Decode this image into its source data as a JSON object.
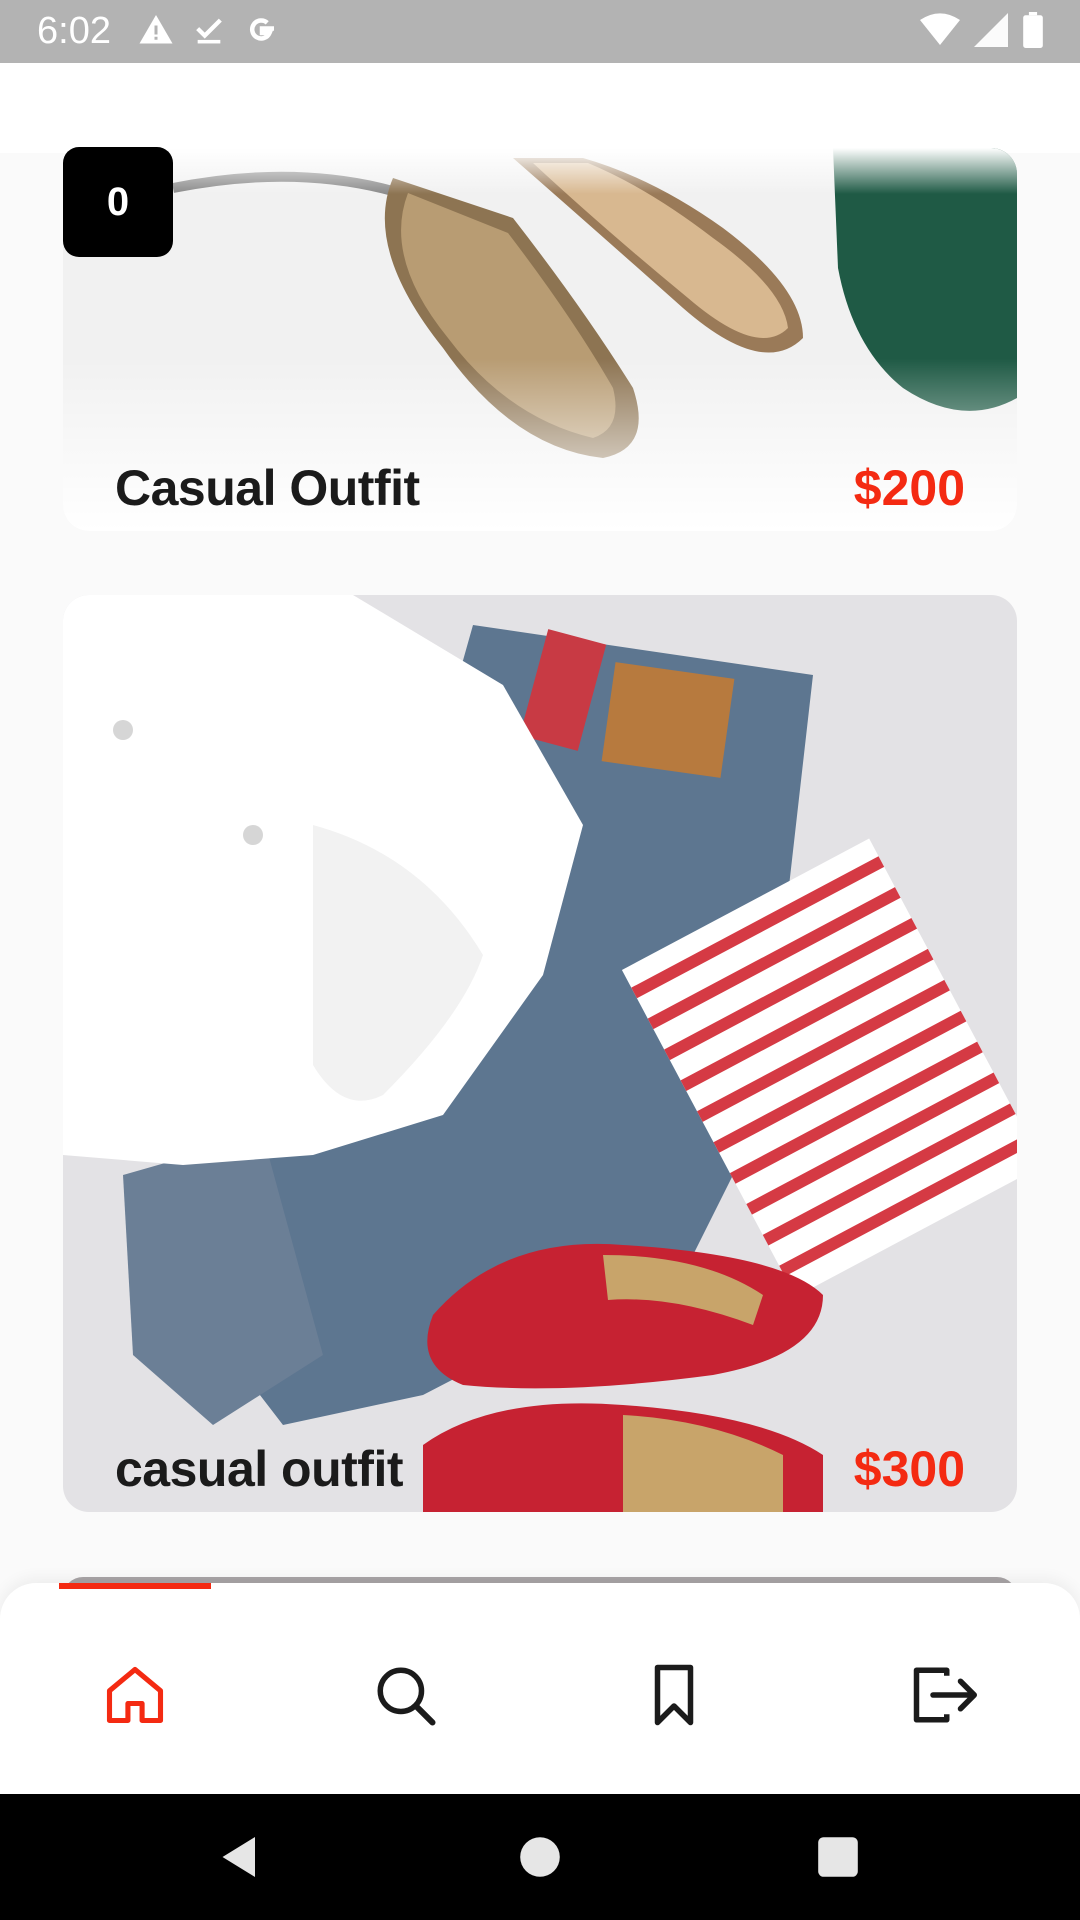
{
  "status_bar": {
    "time": "6:02",
    "left_icons": [
      "warning-icon",
      "download-done-icon",
      "google-icon"
    ],
    "right_icons": [
      "wifi-icon",
      "signal-icon",
      "battery-icon"
    ]
  },
  "cart": {
    "count": "0"
  },
  "posts": [
    {
      "title": "Casual Outfit",
      "price": "$200"
    },
    {
      "title": "casual outfit",
      "price": "$300"
    }
  ],
  "bottom_nav": {
    "active_tab": "home",
    "tabs": [
      "home-icon",
      "search-icon",
      "bookmark-icon",
      "logout-icon"
    ],
    "accent_color": "#f42a12"
  },
  "system_nav": [
    "back-icon",
    "home-circle-icon",
    "recents-icon"
  ]
}
